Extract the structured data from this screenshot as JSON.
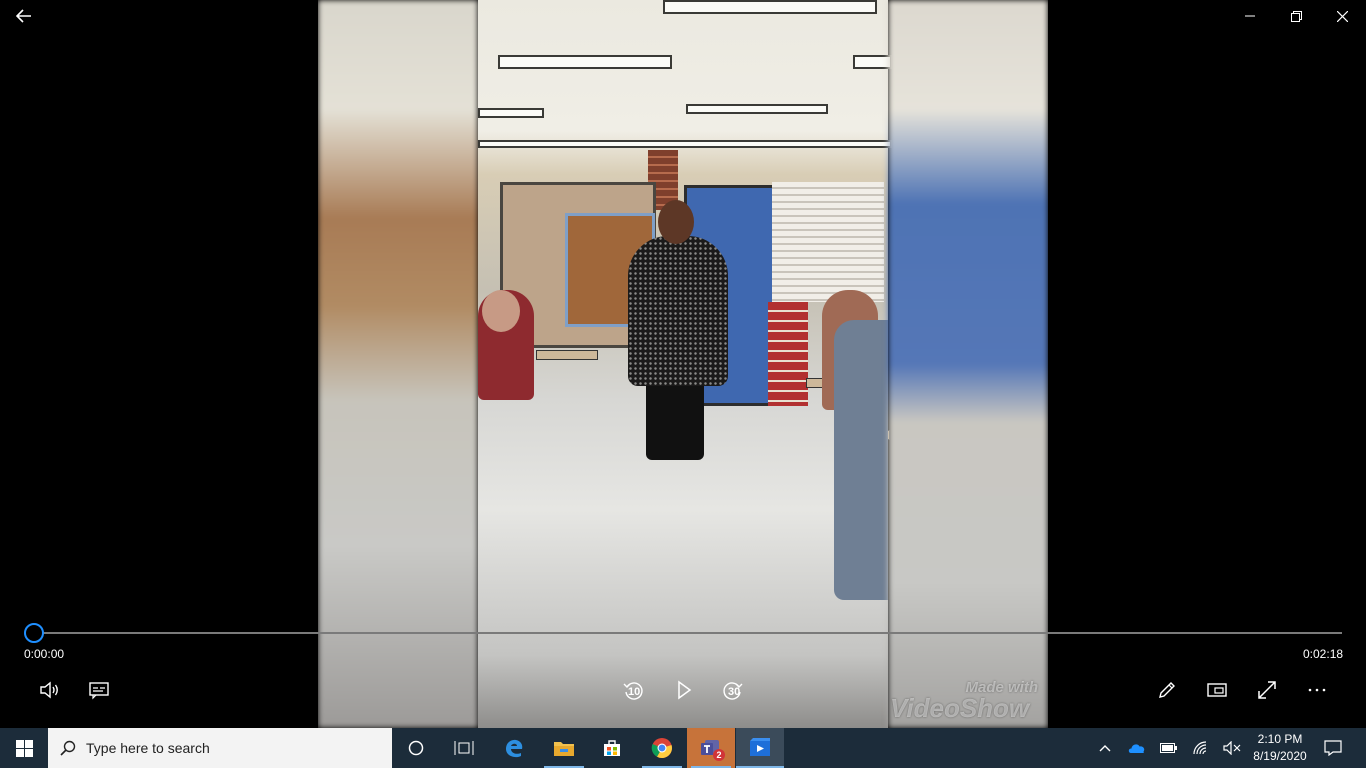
{
  "player": {
    "back_icon": "arrow-left-icon",
    "window_controls": [
      "minimize-icon",
      "restore-icon",
      "close-icon"
    ],
    "current_time": "0:00:00",
    "total_time": "0:02:18",
    "progress": 0.0,
    "skip_back_label": "10",
    "skip_forward_label": "30",
    "watermark": {
      "line1": "Made with",
      "line2": "VideoShow"
    },
    "controls_left": [
      "volume-icon",
      "captions-icon"
    ],
    "controls_right": [
      "edit-pencil-icon",
      "mini-view-icon",
      "fullscreen-icon",
      "more-icon"
    ],
    "accent_color": "#1f8fff"
  },
  "taskbar": {
    "search_placeholder": "Type here to search",
    "apps": [
      "cortana-icon",
      "task-view-icon",
      "edge-icon",
      "file-explorer-icon",
      "store-icon",
      "chrome-icon",
      "teams-icon",
      "movies-tv-icon"
    ],
    "teams_badge": "2",
    "tray_icons": [
      "chevron-up-icon",
      "onedrive-icon",
      "battery-icon",
      "wifi-icon",
      "volume-muted-icon",
      "notifications-icon"
    ],
    "time": "2:10 PM",
    "date": "8/19/2020"
  }
}
